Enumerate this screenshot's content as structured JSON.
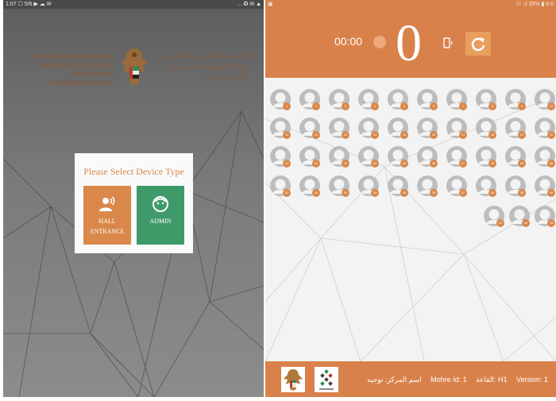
{
  "left_screen": {
    "status_left": "1:07 ☐ 5/6 ▶ ☁ ✉",
    "status_right": "... ✪ ✉ ▲",
    "ministry": {
      "english_lines": [
        "UNITED ARAB EMIRATES",
        "MINISTRY OF HUMAN RESOURCES",
        "& EMIRATISATION"
      ],
      "arabic_lines": [
        "الإمـارات العربيـة المتحـدة",
        "وزارة المـوارد البـشــريــة",
        "والتـــوطيـــن"
      ]
    },
    "dialog": {
      "title": "Please Select Device Type",
      "hall_label": "HALL ENTRANCE",
      "admin_label": "ADMIN"
    },
    "colors": {
      "accent": "#d9884a",
      "admin": "#3f9a6a",
      "background": "#6b6b6b"
    }
  },
  "right_screen": {
    "status_right": "☷ .ıl 35% ▮ 8:0",
    "timer": "00:00",
    "count": "0",
    "icons": {
      "device": "phone-rotate-icon",
      "refresh": "refresh-icon"
    },
    "seats": [
      [
        1,
        2,
        3,
        4,
        5,
        6,
        7,
        8,
        9,
        10
      ],
      [
        11,
        12,
        13,
        14,
        15,
        16,
        17,
        18,
        19,
        20
      ],
      [
        21,
        22,
        23,
        24,
        25,
        26,
        27,
        28,
        29,
        30
      ],
      [
        31,
        32,
        33,
        34,
        35,
        36,
        37,
        38,
        39,
        40
      ],
      [
        41,
        42,
        43
      ]
    ],
    "footer": {
      "version": "Version: 1",
      "hall": "القاعة: H1",
      "mohre_id": "Mohre Id: 1",
      "center": "اسم المركز: توجيه"
    },
    "colors": {
      "accent": "#d9814a",
      "seat": "#bdbdbd"
    }
  }
}
